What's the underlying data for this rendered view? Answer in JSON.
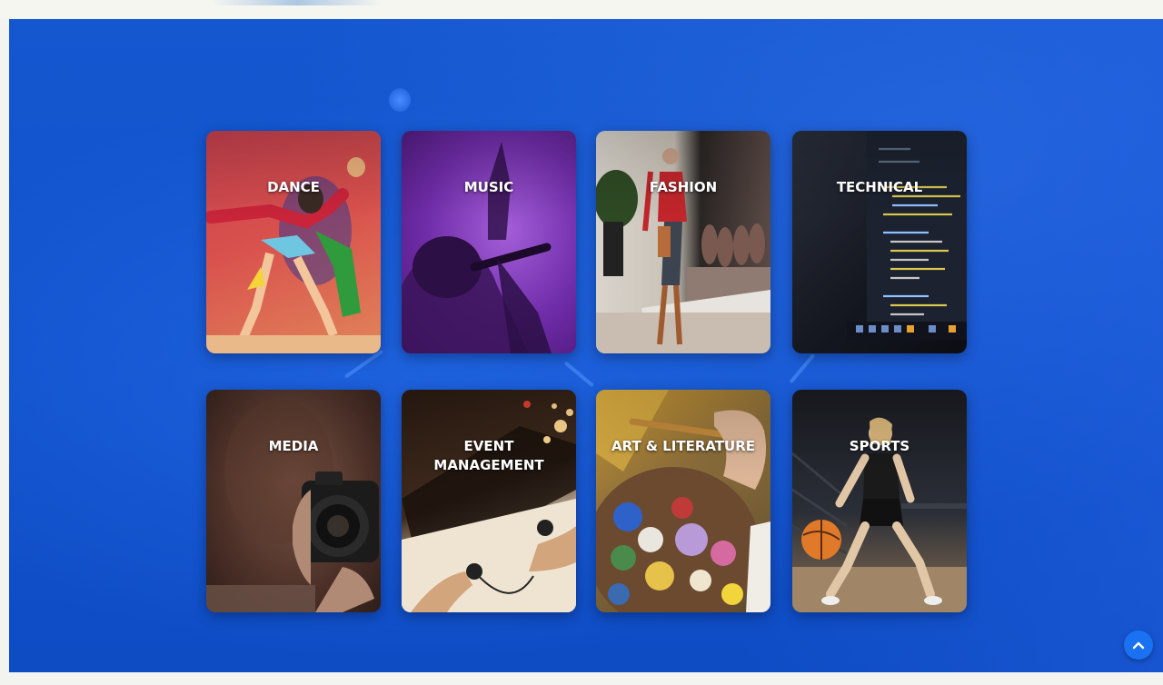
{
  "categories": [
    {
      "id": "dance",
      "label": "DANCE"
    },
    {
      "id": "music",
      "label": "MUSIC"
    },
    {
      "id": "fashion",
      "label": "FASHION"
    },
    {
      "id": "technical",
      "label": "TECHNICAL"
    },
    {
      "id": "media",
      "label": "MEDIA"
    },
    {
      "id": "event",
      "label": "EVENT\nMANAGEMENT"
    },
    {
      "id": "art",
      "label": "ART & LITERATURE"
    },
    {
      "id": "sports",
      "label": "SPORTS"
    }
  ],
  "scroll_top": {
    "icon": "chevron-up-icon",
    "glyph": "⌃"
  },
  "colors": {
    "panel_blue": "#1152cc",
    "scroll_button": "#1a72f2",
    "label_text": "#ffffff"
  }
}
